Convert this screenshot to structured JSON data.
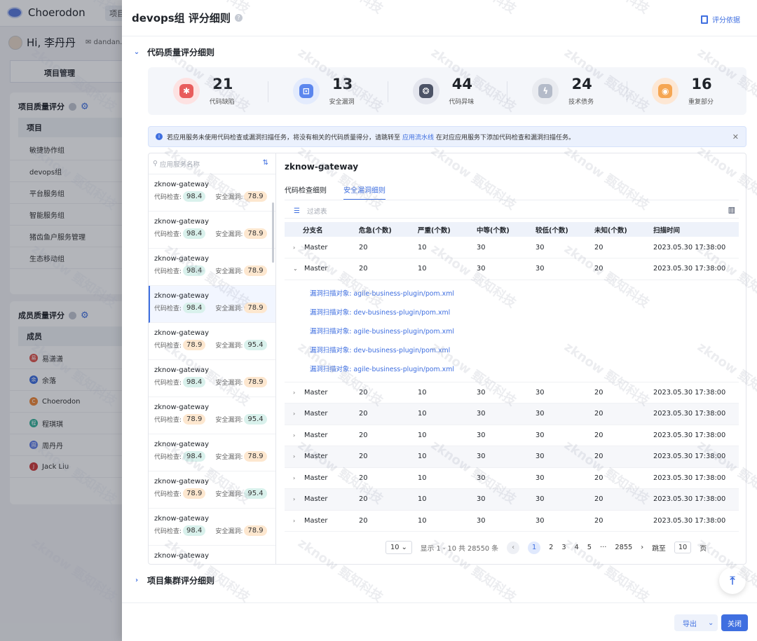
{
  "app": {
    "name": "Choerodon",
    "top_nav": "项目",
    "greeting": "Hi, 李丹丹",
    "email": "dandan.",
    "tab_project_management": "项目管理"
  },
  "project_quality": {
    "title": "项目质量评分",
    "column_header": "项目",
    "items": [
      "敏捷协作组",
      "devops组",
      "平台服务组",
      "智能服务组",
      "猪齿鱼户服务管理",
      "生态移动组"
    ]
  },
  "member_quality": {
    "title": "成员质量评分",
    "column_header": "成员",
    "items": [
      {
        "initial": "易",
        "name": "易潇潇",
        "color": "#e0564d"
      },
      {
        "initial": "余",
        "name": "余落",
        "color": "#3f6fe0"
      },
      {
        "initial": "C",
        "name": "Choerodon",
        "color": "#f08a3a"
      },
      {
        "initial": "程",
        "name": "程琪琪",
        "color": "#36b39a"
      },
      {
        "initial": "周",
        "name": "周丹丹",
        "color": "#5e7ce8"
      },
      {
        "initial": "J",
        "name": "Jack Liu",
        "color": "#d03a3a"
      }
    ]
  },
  "drawer": {
    "title": "devops组 评分细则",
    "basis_label": "评分依据",
    "section_code_quality": "代码质量评分细则",
    "section_cluster": "项目集群评分细则",
    "stats": [
      {
        "value": "21",
        "label": "代码缺陷",
        "icon": "bug-icon",
        "bg": "#fde2e2",
        "fg": "#e85c5c",
        "glyph": "✱"
      },
      {
        "value": "13",
        "label": "安全漏洞",
        "icon": "lock-icon",
        "bg": "#e3ebfd",
        "fg": "#5b86ee",
        "glyph": "⊡"
      },
      {
        "value": "44",
        "label": "代码异味",
        "icon": "smell-icon",
        "bg": "#e4e6ee",
        "fg": "#4c5366",
        "glyph": "❂"
      },
      {
        "value": "24",
        "label": "技术债务",
        "icon": "debt-icon",
        "bg": "#e9ebf0",
        "fg": "#b4bbc9",
        "glyph": "ϟ"
      },
      {
        "value": "16",
        "label": "重复部分",
        "icon": "duplicate-icon",
        "bg": "#fde7d4",
        "fg": "#f5a653",
        "glyph": "◉"
      }
    ],
    "notice": {
      "text_before": "若应用服务未使用代码检查或漏洞扫描任务，将没有相关的代码质量得分，请跳转至",
      "link": "应用流水线",
      "text_after": "在对应应用服务下添加代码检查和漏洞扫描任务。"
    },
    "search_placeholder": "应用服务名称",
    "services": [
      {
        "name": "zknow-gateway",
        "code": "98.4",
        "security": "78.9",
        "code_color": "green",
        "sec_color": "orange"
      },
      {
        "name": "zknow-gateway",
        "code": "98.4",
        "security": "78.9",
        "code_color": "green",
        "sec_color": "orange"
      },
      {
        "name": "zknow-gateway",
        "code": "98.4",
        "security": "78.9",
        "code_color": "green",
        "sec_color": "orange"
      },
      {
        "name": "zknow-gateway",
        "code": "98.4",
        "security": "78.9",
        "code_color": "green",
        "sec_color": "orange",
        "active": true
      },
      {
        "name": "zknow-gateway",
        "code": "78.9",
        "security": "95.4",
        "code_color": "orange",
        "sec_color": "green"
      },
      {
        "name": "zknow-gateway",
        "code": "98.4",
        "security": "78.9",
        "code_color": "green",
        "sec_color": "orange"
      },
      {
        "name": "zknow-gateway",
        "code": "78.9",
        "security": "95.4",
        "code_color": "orange",
        "sec_color": "green"
      },
      {
        "name": "zknow-gateway",
        "code": "98.4",
        "security": "78.9",
        "code_color": "green",
        "sec_color": "orange"
      },
      {
        "name": "zknow-gateway",
        "code": "78.9",
        "security": "95.4",
        "code_color": "orange",
        "sec_color": "green"
      },
      {
        "name": "zknow-gateway",
        "code": "98.4",
        "security": "78.9",
        "code_color": "green",
        "sec_color": "orange"
      },
      {
        "name": "zknow-gateway",
        "code": "",
        "security": "",
        "code_color": "green",
        "sec_color": "orange"
      }
    ],
    "code_label": "代码检查:",
    "security_label": "安全漏洞:",
    "detail_title": "zknow-gateway",
    "tabs": [
      "代码检查细则",
      "安全漏洞细则"
    ],
    "active_tab": 1,
    "filter_placeholder": "过滤表",
    "columns": [
      "分支名",
      "危急(个数)",
      "严重(个数)",
      "中等(个数)",
      "较低(个数)",
      "未知(个数)",
      "扫描时间"
    ],
    "rows": [
      {
        "branch": "Master",
        "critical": "20",
        "severe": "10",
        "medium": "30",
        "low": "30",
        "unknown": "20",
        "time": "2023.05.30  17:38:00",
        "expanded": false
      },
      {
        "branch": "Master",
        "critical": "20",
        "severe": "10",
        "medium": "30",
        "low": "30",
        "unknown": "20",
        "time": "2023.05.30  17:38:00",
        "expanded": true
      },
      {
        "branch": "Master",
        "critical": "20",
        "severe": "10",
        "medium": "30",
        "low": "30",
        "unknown": "20",
        "time": "2023.05.30  17:38:00",
        "expanded": false
      },
      {
        "branch": "Master",
        "critical": "20",
        "severe": "10",
        "medium": "30",
        "low": "30",
        "unknown": "20",
        "time": "2023.05.30  17:38:00",
        "expanded": false
      },
      {
        "branch": "Master",
        "critical": "20",
        "severe": "10",
        "medium": "30",
        "low": "30",
        "unknown": "20",
        "time": "2023.05.30  17:38:00",
        "expanded": false
      },
      {
        "branch": "Master",
        "critical": "20",
        "severe": "10",
        "medium": "30",
        "low": "30",
        "unknown": "20",
        "time": "2023.05.30  17:38:00",
        "expanded": false
      },
      {
        "branch": "Master",
        "critical": "20",
        "severe": "10",
        "medium": "30",
        "low": "30",
        "unknown": "20",
        "time": "2023.05.30  17:38:00",
        "expanded": false
      },
      {
        "branch": "Master",
        "critical": "20",
        "severe": "10",
        "medium": "30",
        "low": "30",
        "unknown": "20",
        "time": "2023.05.30  17:38:00",
        "expanded": false
      },
      {
        "branch": "Master",
        "critical": "20",
        "severe": "10",
        "medium": "30",
        "low": "30",
        "unknown": "20",
        "time": "2023.05.30  17:38:00",
        "expanded": false
      }
    ],
    "scan_targets": [
      "漏洞扫描对象: agile-business-plugin/pom.xml",
      "漏洞扫描对象: dev-business-plugin/pom.xml",
      "漏洞扫描对象: agile-business-plugin/pom.xml",
      "漏洞扫描对象: dev-business-plugin/pom.xml",
      "漏洞扫描对象: agile-business-plugin/pom.xml"
    ],
    "pager": {
      "page_size": "10",
      "total_text": "显示 1 - 10 共 28550 条",
      "pages": [
        "1",
        "2",
        "3",
        "4",
        "5",
        "···",
        "2855"
      ],
      "current": "1",
      "jump_label": "跳至",
      "jump_value": "10",
      "page_unit": "页"
    },
    "export_label": "导出",
    "close_label": "关闭"
  },
  "watermark": "zknow 甄知科技"
}
